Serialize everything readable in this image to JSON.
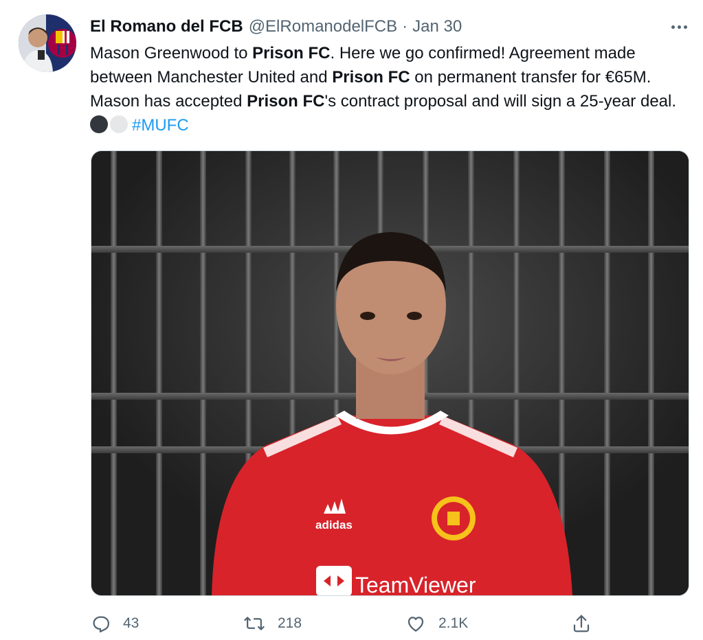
{
  "author": {
    "display_name": "El Romano del FCB",
    "handle": "@ElRomanodelFCB",
    "separator": "·",
    "date": "Jan 30"
  },
  "tweet": {
    "segments": [
      {
        "text": "Mason Greenwood to ",
        "bold": false
      },
      {
        "text": "Prison FC",
        "bold": true
      },
      {
        "text": ". Here we go confirmed! Agreement made between Manchester United and ",
        "bold": false
      },
      {
        "text": "Prison FC",
        "bold": true
      },
      {
        "text": " on permanent transfer for €65M. Mason has accepted ",
        "bold": false
      },
      {
        "text": "Prison FC",
        "bold": true
      },
      {
        "text": "'s contract proposal and will sign a 25-year deal.",
        "bold": false
      }
    ],
    "emoji": [
      "dark-circle",
      "white-circle"
    ],
    "hashtag": "#MUFC"
  },
  "media": {
    "shirt_texts": {
      "brand": "adidas",
      "sponsor": "TeamViewer"
    },
    "colors": {
      "shirt": "#d8232a",
      "bars": "#5a5a5a",
      "background": "#2a2a2a"
    }
  },
  "actions": {
    "reply": {
      "icon": "reply-icon",
      "count": "43"
    },
    "retweet": {
      "icon": "retweet-icon",
      "count": "218"
    },
    "like": {
      "icon": "heart-icon",
      "count": "2.1K"
    },
    "share": {
      "icon": "share-icon"
    }
  },
  "theme": {
    "text": "#0f1419",
    "secondary": "#536471",
    "link": "#1d9bf0"
  }
}
